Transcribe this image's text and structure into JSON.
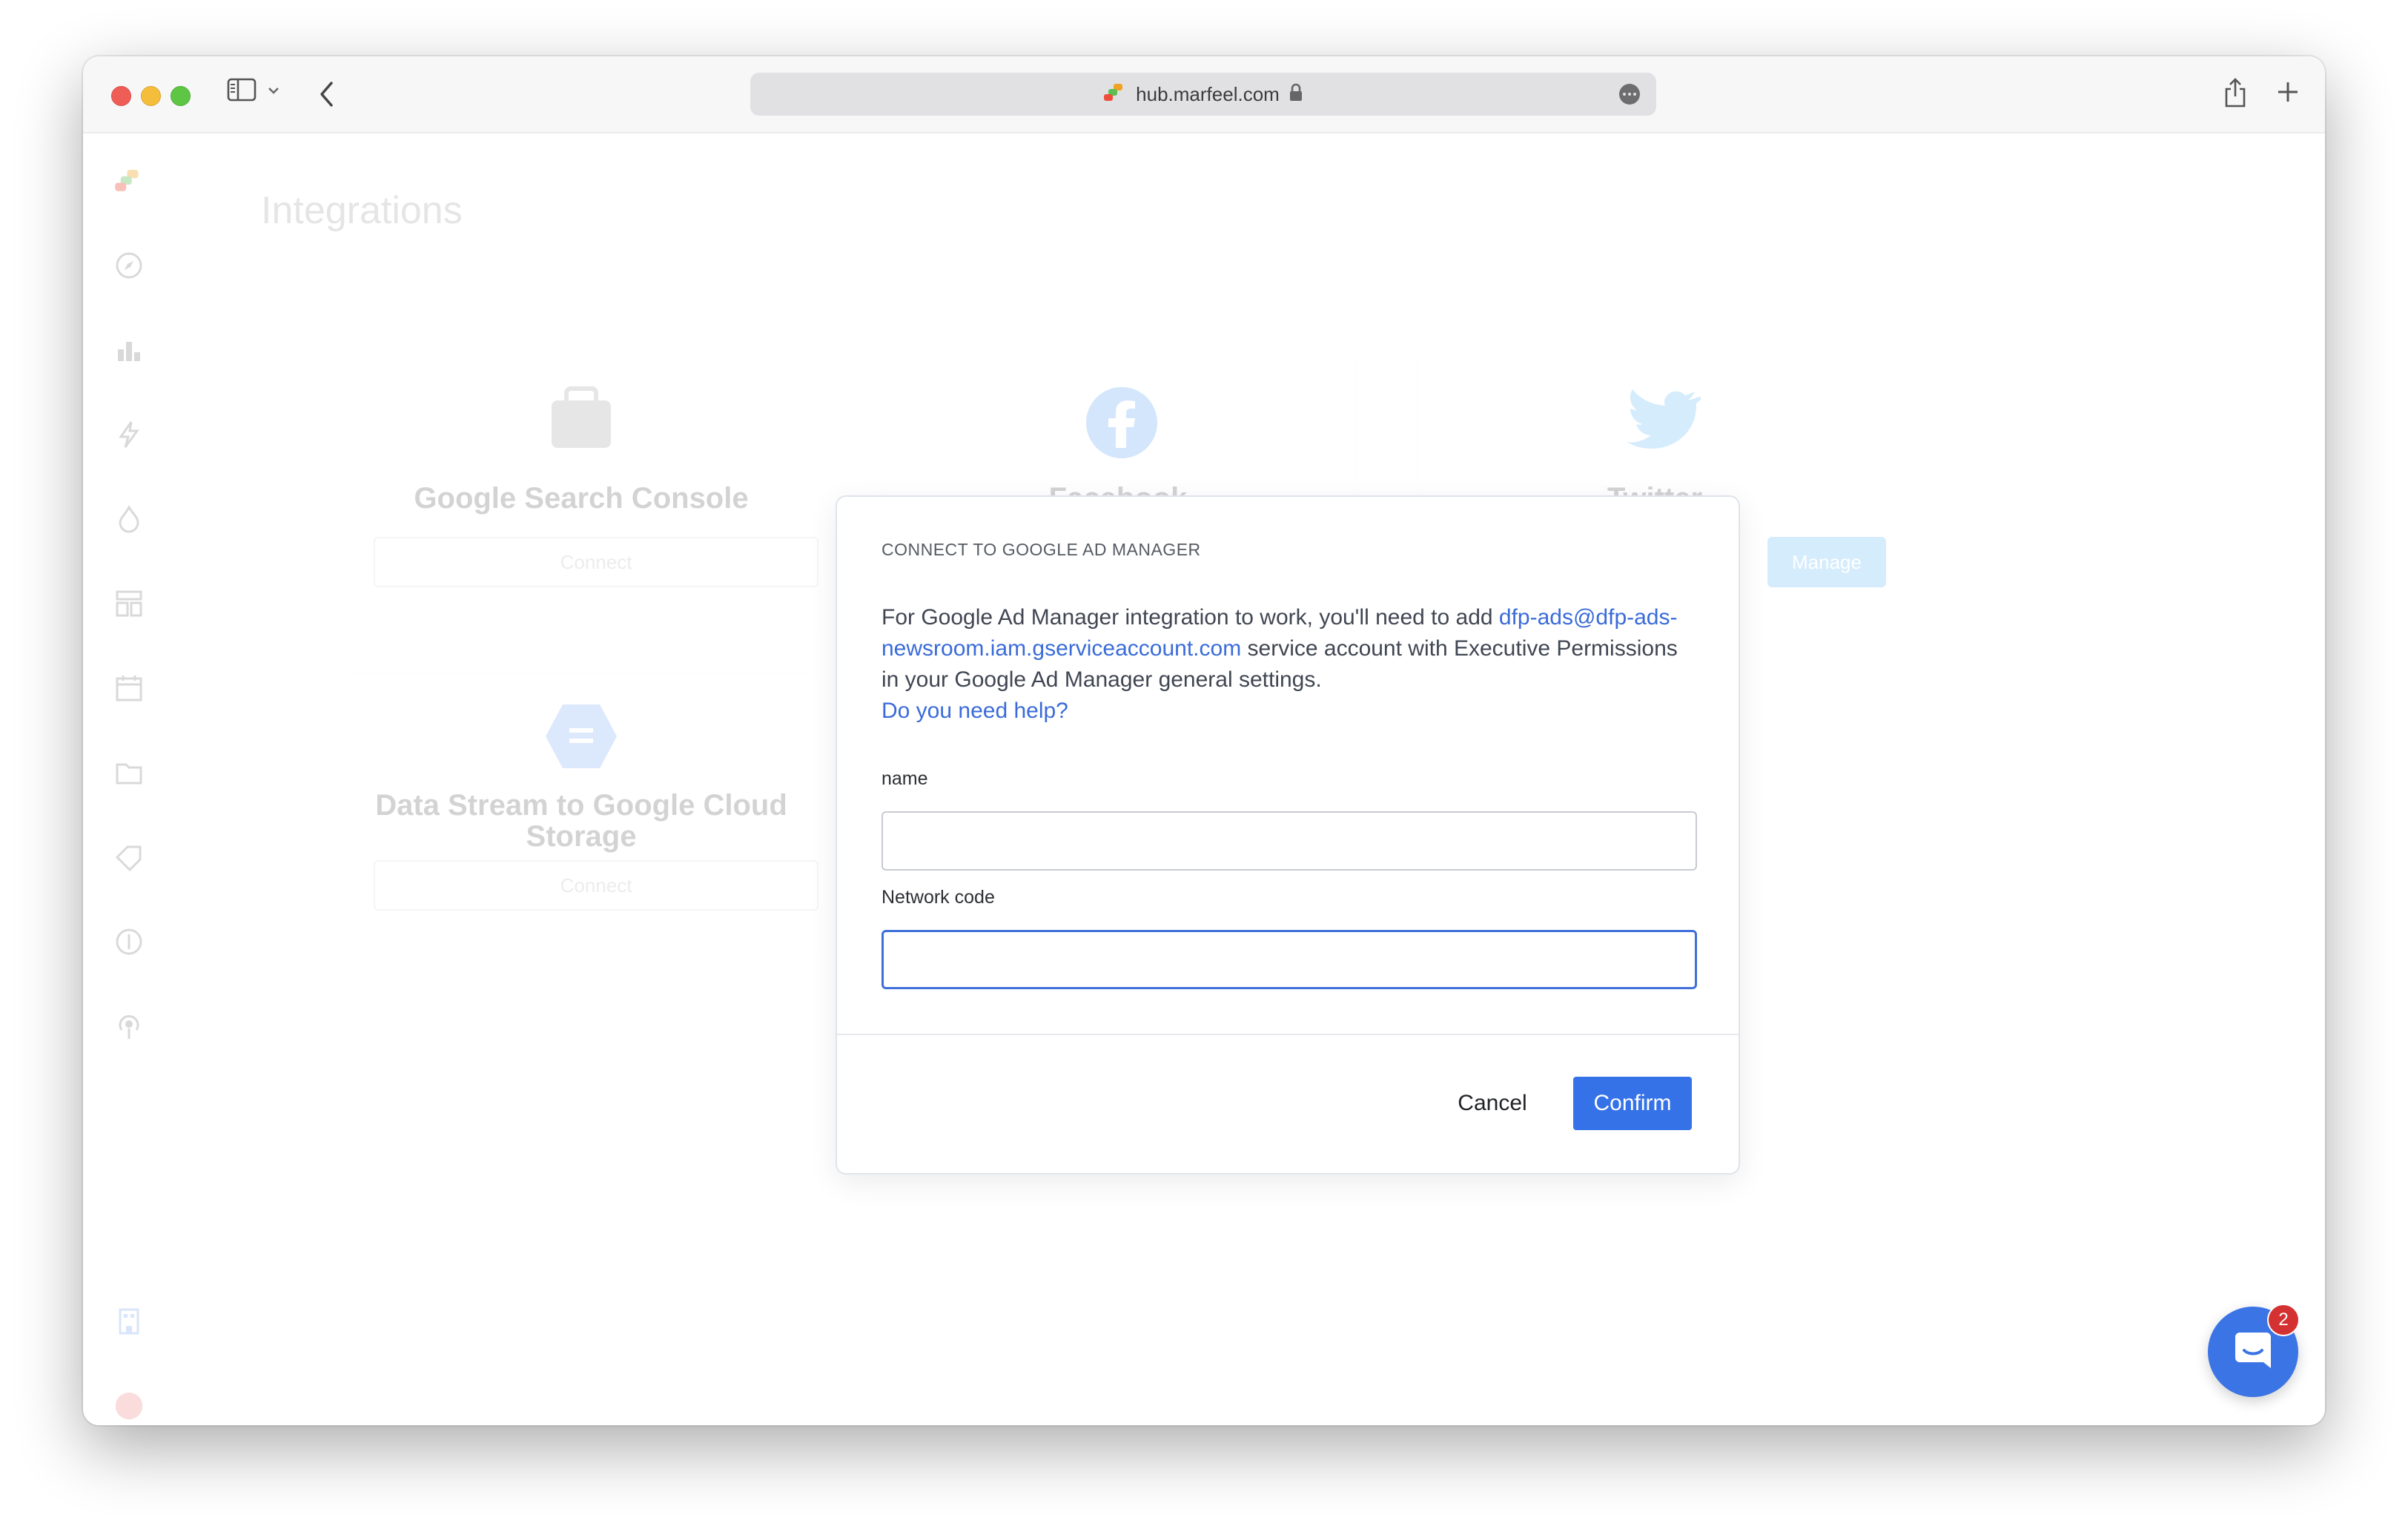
{
  "browser": {
    "url": "hub.marfeel.com",
    "icons": [
      "sidebar-toggle-icon",
      "chevron-down-icon",
      "back-arrow-icon",
      "site-favicon",
      "lock-icon",
      "more-icon",
      "share-icon",
      "new-tab-icon"
    ]
  },
  "background_page": {
    "title": "Integrations",
    "cards": [
      {
        "name": "Google Search Console",
        "action": "Connect"
      },
      {
        "name": "Facebook",
        "action": ""
      },
      {
        "name": "Twitter",
        "action": "Manage"
      },
      {
        "name": "Data Stream to Google Cloud Storage",
        "action": "Connect"
      }
    ]
  },
  "modal": {
    "title": "CONNECT TO GOOGLE AD MANAGER",
    "desc_before": "For Google Ad Manager integration to work, you'll need to add ",
    "desc_link": "dfp-ads@dfp-ads-newsroom.iam.gserviceaccount.com",
    "desc_after": " service account with Executive Permissions in your Google Ad Manager general settings.",
    "help_link": "Do you need help?",
    "fields": {
      "name": {
        "label": "name",
        "value": "",
        "placeholder": ""
      },
      "network_code": {
        "label": "Network code",
        "value": "",
        "placeholder": ""
      }
    },
    "buttons": {
      "cancel": "Cancel",
      "confirm": "Confirm"
    }
  },
  "chat_widget": {
    "badge_count": "2"
  },
  "colors": {
    "accent": "#3572e8",
    "link": "#3a6bd8",
    "badge": "#d43232"
  }
}
